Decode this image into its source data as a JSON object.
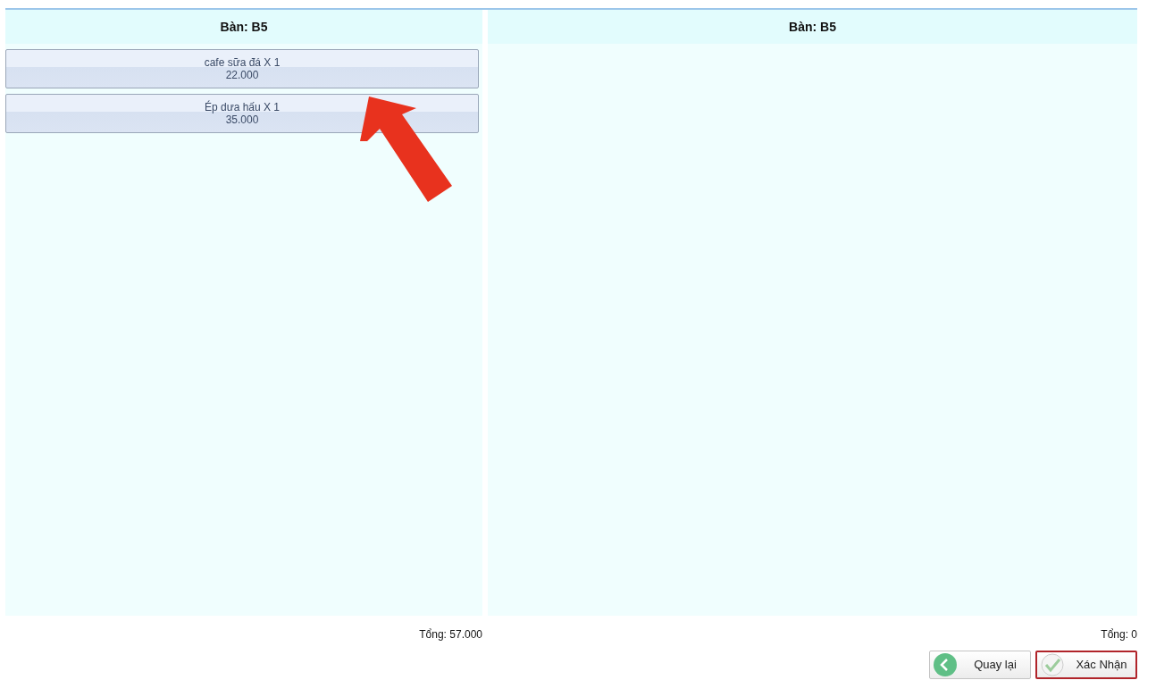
{
  "panels": [
    {
      "title": "Bàn: B5",
      "items": [
        {
          "name": "cafe sữa đá X 1",
          "price": "22.000"
        },
        {
          "name": "Ép dưa hấu X 1",
          "price": "35.000"
        }
      ],
      "total": "Tổng: 57.000"
    },
    {
      "title": "Bàn: B5",
      "total": "Tổng: 0"
    }
  ],
  "buttons": [
    {
      "label": "Quay lại",
      "kind": "back",
      "highlighted": false
    },
    {
      "label": "Xác Nhận",
      "kind": "confirm",
      "highlighted": true
    }
  ]
}
